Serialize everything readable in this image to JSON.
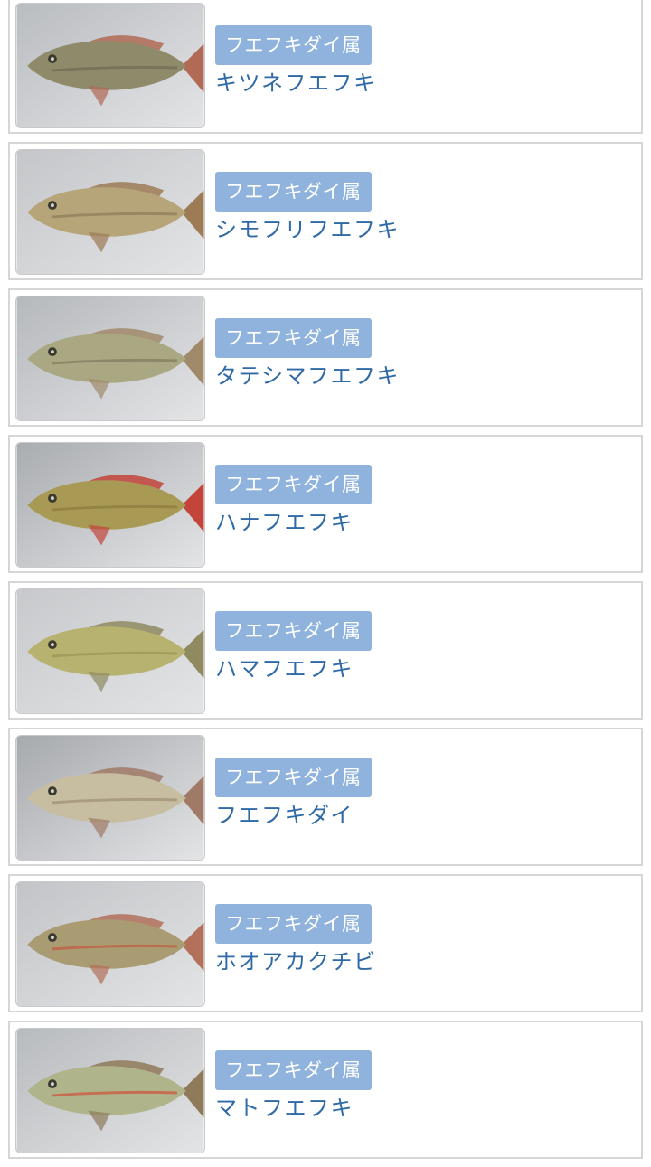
{
  "items": [
    {
      "genus": "フエフキダイ属",
      "name": "キツネフエフキ",
      "photo": "fish-photo",
      "bg": "#b9bcc0",
      "fish": "#8f8a6a",
      "fin": "#b06a55",
      "accent": "#6e6a52"
    },
    {
      "genus": "フエフキダイ属",
      "name": "シモフリフエフキ",
      "photo": "fish-photo",
      "bg": "#c4c6c9",
      "fish": "#b7a57a",
      "fin": "#9c7b55",
      "accent": "#8a7b58"
    },
    {
      "genus": "フエフキダイ属",
      "name": "タテシマフエフキ",
      "photo": "fish-photo",
      "bg": "#b5b8bc",
      "fish": "#a9a882",
      "fin": "#a08a6a",
      "accent": "#7f7a5c"
    },
    {
      "genus": "フエフキダイ属",
      "name": "ハナフエフキ",
      "photo": "fish-photo",
      "bg": "#a9acb0",
      "fish": "#a89a55",
      "fin": "#c2443a",
      "accent": "#8a7a3c"
    },
    {
      "genus": "フエフキダイ属",
      "name": "ハマフエフキ",
      "photo": "fish-photo",
      "bg": "#c7c9cc",
      "fish": "#b8b270",
      "fin": "#8f8a60",
      "accent": "#9a9455"
    },
    {
      "genus": "フエフキダイ属",
      "name": "フエフキダイ",
      "photo": "fish-photo",
      "bg": "#a6a9ad",
      "fish": "#c7bda0",
      "fin": "#a07a66",
      "accent": "#9c8f72"
    },
    {
      "genus": "フエフキダイ属",
      "name": "ホオアカクチビ",
      "photo": "fish-photo",
      "bg": "#c2c4c7",
      "fish": "#a99b72",
      "fin": "#b3705a",
      "accent": "#c4573e"
    },
    {
      "genus": "フエフキダイ属",
      "name": "マトフエフキ",
      "photo": "fish-photo",
      "bg": "#b8bbbe",
      "fish": "#b0b48a",
      "fin": "#8f7a5a",
      "accent": "#d0503a"
    }
  ]
}
